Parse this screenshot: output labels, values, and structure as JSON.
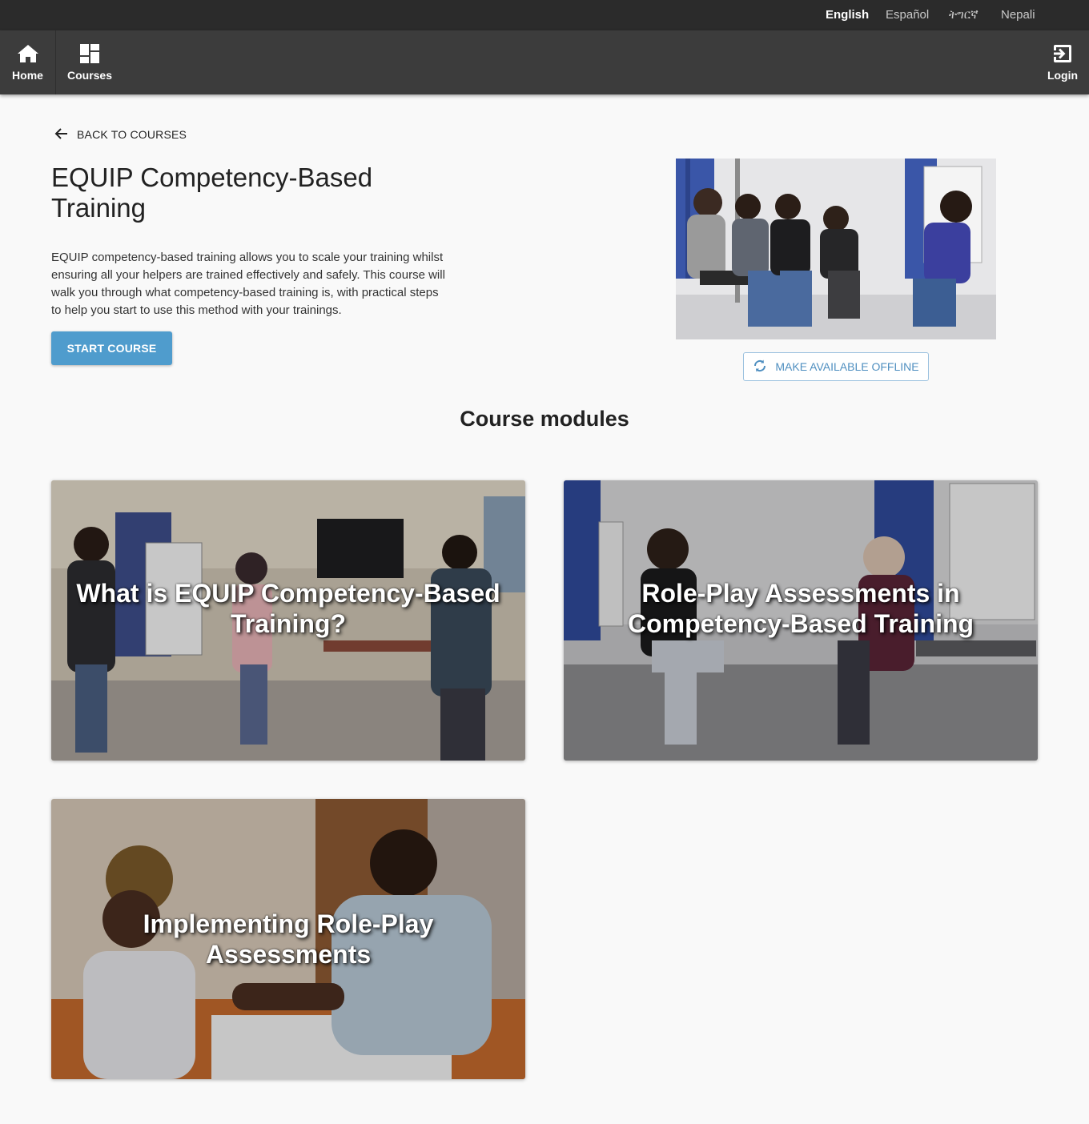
{
  "languages": [
    {
      "label": "English",
      "active": true
    },
    {
      "label": "Español",
      "active": false
    },
    {
      "label": "ትግርኛ",
      "active": false
    },
    {
      "label": "Nepali",
      "active": false
    }
  ],
  "nav": {
    "home": {
      "label": "Home",
      "icon": "home-icon"
    },
    "courses": {
      "label": "Courses",
      "icon": "dashboard-icon"
    },
    "login": {
      "label": "Login",
      "icon": "login-icon"
    }
  },
  "course": {
    "back_label": "BACK TO COURSES",
    "title": "EQUIP Competency-Based Training",
    "description": "EQUIP competency-based training allows you to scale your training whilst ensuring all your helpers are trained effectively and safely. This course will walk you through what competency-based training is, with practical steps to help you start to use this method with your trainings.",
    "start_label": "START COURSE",
    "offline_label": "MAKE AVAILABLE OFFLINE"
  },
  "modules": {
    "heading": "Course modules",
    "items": [
      {
        "title": "What is EQUIP Competency-Based Training?"
      },
      {
        "title": "Role-Play Assessments in Competency-Based Training"
      },
      {
        "title": "Implementing Role-Play Assessments"
      }
    ]
  },
  "colors": {
    "langbar": "#2b2b2b",
    "navbar": "#3c3c3c",
    "primary": "#4f9ccd",
    "background": "#f9f9f9"
  }
}
